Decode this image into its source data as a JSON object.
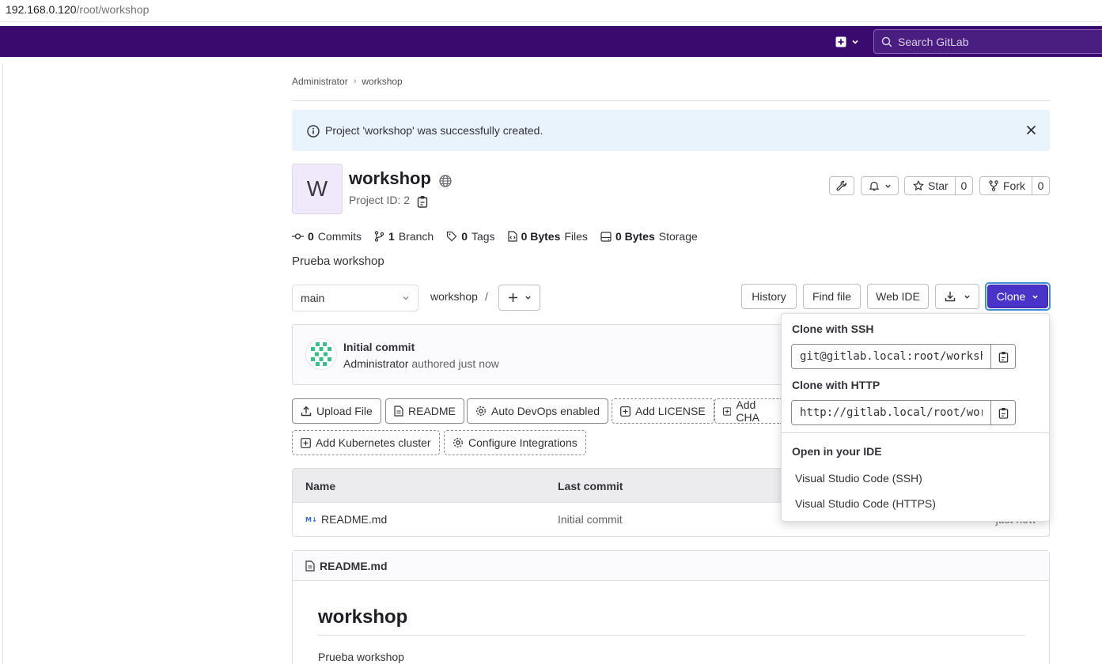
{
  "browser": {
    "url_host": "192.168.0.120",
    "url_path": "/root/workshop"
  },
  "topbar": {
    "search_placeholder": "Search GitLab"
  },
  "breadcrumb": {
    "items": [
      "Administrator",
      "workshop"
    ]
  },
  "alert": {
    "message": "Project 'workshop' was successfully created."
  },
  "project": {
    "avatar_letter": "W",
    "name": "workshop",
    "id_label": "Project ID: 2",
    "description": "Prueba workshop"
  },
  "actions": {
    "star_label": "Star",
    "star_count": "0",
    "fork_label": "Fork",
    "fork_count": "0"
  },
  "stats": [
    {
      "value": "0",
      "label": "Commits"
    },
    {
      "value": "1",
      "label": "Branch"
    },
    {
      "value": "0",
      "label": "Tags"
    },
    {
      "value": "0 Bytes",
      "label": "Files"
    },
    {
      "value": "0 Bytes",
      "label": "Storage"
    }
  ],
  "repo_nav": {
    "branch": "main",
    "path": "workshop",
    "path_sep": "/",
    "history": "History",
    "find_file": "Find file",
    "web_ide": "Web IDE",
    "clone": "Clone"
  },
  "last_commit": {
    "title": "Initial commit",
    "author": "Administrator",
    "meta": "authored just now"
  },
  "quick_actions": {
    "upload_file": "Upload File",
    "readme": "README",
    "auto_devops": "Auto DevOps enabled",
    "add_license": "Add LICENSE",
    "add_changelog": "Add CHA",
    "add_k8s": "Add Kubernetes cluster",
    "configure_integrations": "Configure Integrations"
  },
  "file_table": {
    "headers": {
      "name": "Name",
      "last_commit": "Last commit"
    },
    "rows": [
      {
        "name": "README.md",
        "commit": "Initial commit",
        "time": "just now"
      }
    ]
  },
  "readme": {
    "filename": "README.md",
    "heading": "workshop",
    "body": "Prueba workshop"
  },
  "clone_dropdown": {
    "ssh_label": "Clone with SSH",
    "ssh_url": "git@gitlab.local:root/workshop.git",
    "http_label": "Clone with HTTP",
    "http_url": "http://gitlab.local/root/workshop.git",
    "ide_label": "Open in your IDE",
    "ide_items": [
      "Visual Studio Code (SSH)",
      "Visual Studio Code (HTTPS)"
    ]
  },
  "colors": {
    "topbar": "#3a0a6e",
    "primary_button": "#4a34c8",
    "alert_bg": "#e9f3fc"
  }
}
